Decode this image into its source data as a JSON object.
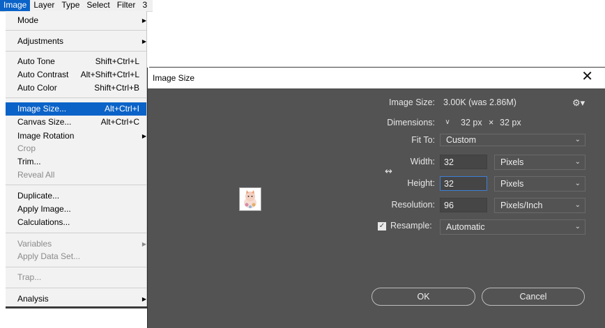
{
  "menubar": {
    "items": [
      "Image",
      "Layer",
      "Type",
      "Select",
      "Filter",
      "3"
    ]
  },
  "image_menu": {
    "mode": "Mode",
    "adjustments": "Adjustments",
    "auto_tone": {
      "label": "Auto Tone",
      "shortcut": "Shift+Ctrl+L"
    },
    "auto_contrast": {
      "label": "Auto Contrast",
      "shortcut": "Alt+Shift+Ctrl+L"
    },
    "auto_color": {
      "label": "Auto Color",
      "shortcut": "Shift+Ctrl+B"
    },
    "image_size": {
      "label": "Image Size...",
      "shortcut": "Alt+Ctrl+I"
    },
    "canvas_size": {
      "label": "Canvas Size...",
      "shortcut": "Alt+Ctrl+C"
    },
    "image_rotation": "Image Rotation",
    "crop": "Crop",
    "trim": "Trim...",
    "reveal_all": "Reveal All",
    "duplicate": "Duplicate...",
    "apply_image": "Apply Image...",
    "calculations": "Calculations...",
    "variables": "Variables",
    "apply_data_set": "Apply Data Set...",
    "trap": "Trap...",
    "analysis": "Analysis"
  },
  "dialog": {
    "title": "Image Size",
    "image_size_label": "Image Size:",
    "image_size_value": "3.00K (was 2.86M)",
    "dimensions_label": "Dimensions:",
    "dim_width": "32 px",
    "dim_times": "×",
    "dim_height": "32 px",
    "fit_to_label": "Fit To:",
    "fit_to_value": "Custom",
    "width_label": "Width:",
    "width_value": "32",
    "width_unit": "Pixels",
    "height_label": "Height:",
    "height_value": "32",
    "height_unit": "Pixels",
    "resolution_label": "Resolution:",
    "resolution_value": "96",
    "resolution_unit": "Pixels/Inch",
    "resample_label": "Resample:",
    "resample_value": "Automatic",
    "ok_label": "OK",
    "cancel_label": "Cancel"
  },
  "colors": {
    "menu_highlight": "#0b63c8",
    "dialog_bg": "#535353",
    "focus_border": "#3d7fd7"
  }
}
